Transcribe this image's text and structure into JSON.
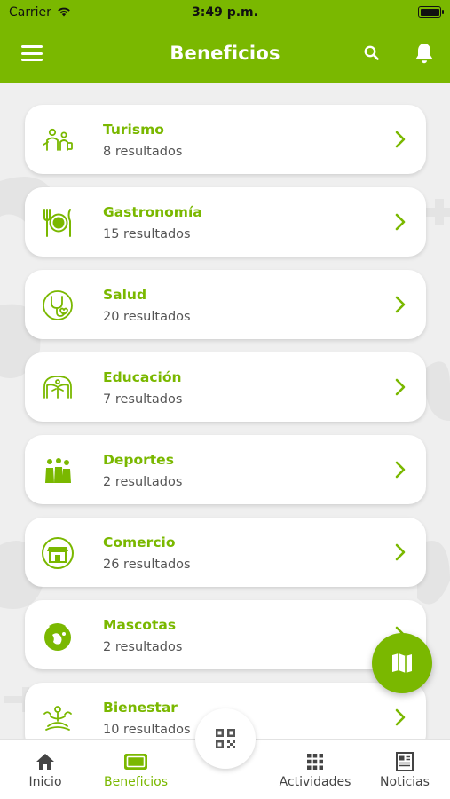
{
  "status_bar": {
    "carrier": "Carrier",
    "time": "3:49 p.m."
  },
  "header": {
    "title": "Beneficios",
    "menu_icon": "hamburger-menu-icon",
    "search_icon": "search-icon",
    "notifications_icon": "bell-icon"
  },
  "categories": [
    {
      "title": "Turismo",
      "subtitle": "8 resultados",
      "icon": "tourism-icon"
    },
    {
      "title": "Gastronomía",
      "subtitle": "15 resultados",
      "icon": "plate-cutlery-icon"
    },
    {
      "title": "Salud",
      "subtitle": "20 resultados",
      "icon": "stethoscope-icon"
    },
    {
      "title": "Educación",
      "subtitle": "7 resultados",
      "icon": "education-book-icon"
    },
    {
      "title": "Deportes",
      "subtitle": "2 resultados",
      "icon": "sports-icon"
    },
    {
      "title": "Comercio",
      "subtitle": "26 resultados",
      "icon": "store-icon"
    },
    {
      "title": "Mascotas",
      "subtitle": "2 resultados",
      "icon": "pet-icon"
    },
    {
      "title": "Bienestar",
      "subtitle": "10 resultados",
      "icon": "lotus-wellness-icon"
    }
  ],
  "fab": {
    "icon": "map-icon"
  },
  "tabbar": {
    "tabs": [
      {
        "label": "Inicio",
        "icon": "home-icon",
        "active": false
      },
      {
        "label": "Beneficios",
        "icon": "card-icon",
        "active": true
      },
      {
        "label": "Actividades",
        "icon": "grid-icon",
        "active": false
      },
      {
        "label": "Noticias",
        "icon": "newspaper-icon",
        "active": false
      }
    ],
    "center_button_icon": "qr-code-icon"
  },
  "colors": {
    "brand_green": "#7ab800",
    "background": "#efefef",
    "card_background": "#ffffff",
    "subtitle_text": "#555555"
  }
}
